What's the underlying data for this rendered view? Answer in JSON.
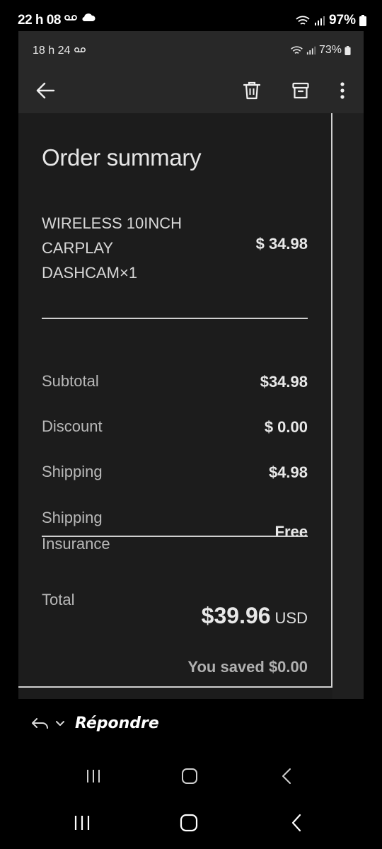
{
  "outer_status": {
    "time": "22 h 08",
    "battery": "97%"
  },
  "inner_status": {
    "time": "18 h 24",
    "battery": "73%"
  },
  "toolbar": {
    "back_icon": "arrow-left-icon",
    "delete_icon": "trash-icon",
    "archive_icon": "archive-icon",
    "more_icon": "more-vertical-icon"
  },
  "order": {
    "title": "Order summary",
    "item": {
      "name_lines": [
        "WIRELESS 10INCH",
        "CARPLAY",
        "DASHCAM×1"
      ],
      "price": "$ 34.98"
    },
    "rows": [
      {
        "label": "Subtotal",
        "value": "$34.98"
      },
      {
        "label": "Discount",
        "value": "$ 0.00"
      },
      {
        "label": "Shipping",
        "value": "$4.98"
      }
    ],
    "insurance": {
      "label_lines": [
        "Shipping",
        "Insurance"
      ],
      "value": "Free"
    },
    "total": {
      "label": "Total",
      "amount": "$39.96",
      "currency": "USD"
    },
    "saved": "You saved $0.00"
  },
  "reply": {
    "label": "Répondre"
  },
  "colors": {
    "background": "#000000",
    "panel": "#1c1c1c",
    "toolbar": "#282828",
    "divider": "#cfcfcf"
  }
}
